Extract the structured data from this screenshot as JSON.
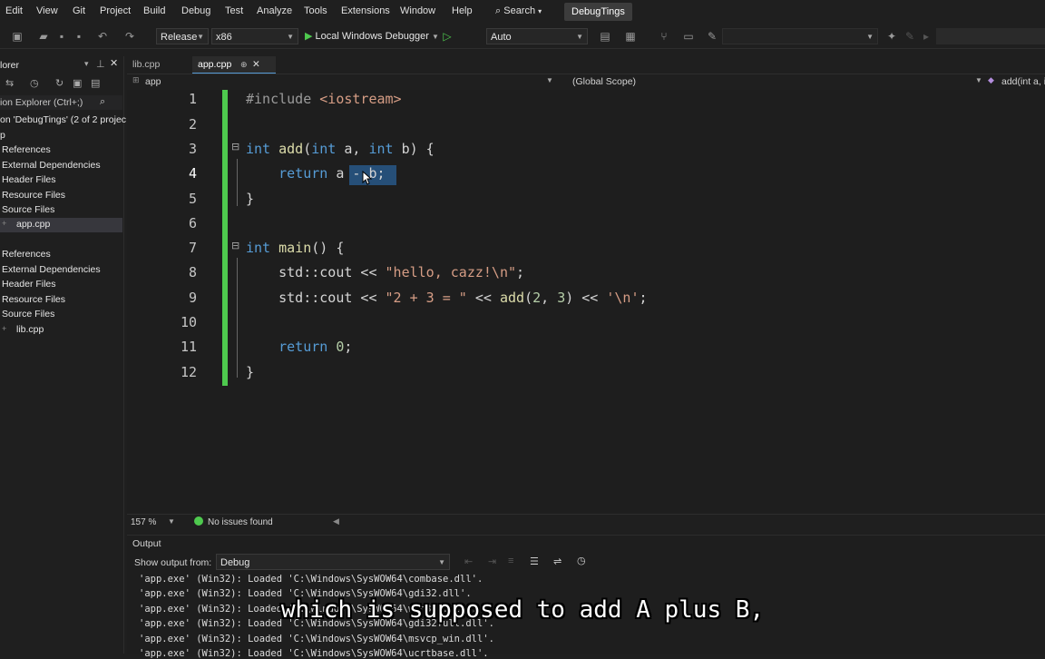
{
  "menu": [
    "Edit",
    "View",
    "Git",
    "Project",
    "Build",
    "Debug",
    "Test",
    "Analyze",
    "Tools",
    "Extensions",
    "Window",
    "Help"
  ],
  "search_label": "Search",
  "solution_name": "DebugTings",
  "toolbar": {
    "config": "Release",
    "platform": "x86",
    "debugger": "Local Windows Debugger",
    "auto": "Auto"
  },
  "solution_explorer": {
    "title": "lorer",
    "search_placeholder": "ion Explorer (Ctrl+;)",
    "solution_line": "on 'DebugTings' (2 of 2 projec",
    "project_marker": "p",
    "items": [
      "References",
      "External Dependencies",
      "Header Files",
      "Resource Files",
      "Source Files",
      "app.cpp",
      "References",
      "External Dependencies",
      "Header Files",
      "Resource Files",
      "Source Files",
      "lib.cpp"
    ]
  },
  "tabs": [
    {
      "label": "lib.cpp"
    },
    {
      "label": "app.cpp",
      "pin": "⊕"
    }
  ],
  "navbar": {
    "project": "app",
    "scope": "(Global Scope)",
    "member": "add(int a, i"
  },
  "editor": {
    "line_numbers": [
      "1",
      "2",
      "3",
      "4",
      "5",
      "6",
      "7",
      "8",
      "9",
      "10",
      "11",
      "12"
    ],
    "zoom": "157 %",
    "issues": "No issues found"
  },
  "output": {
    "title": "Output",
    "show_from_label": "Show output from:",
    "source": "Debug",
    "lines": [
      "'app.exe' (Win32): Loaded 'C:\\Windows\\SysWOW64\\combase.dll'.",
      "'app.exe' (Win32): Loaded 'C:\\Windows\\SysWOW64\\gdi32.dll'.",
      "'app.exe' (Win32): Loaded 'C:\\Windows\\SysWOW64\\win32u.dll'.",
      "'app.exe' (Win32): Loaded 'C:\\Windows\\SysWOW64\\gdi32full.dll'.",
      "'app.exe' (Win32): Loaded 'C:\\Windows\\SysWOW64\\msvcp_win.dll'.",
      "'app.exe' (Win32): Loaded 'C:\\Windows\\SysWOW64\\ucrtbase.dll'."
    ]
  },
  "subtitle": "which is supposed to add A plus B,",
  "colors": {
    "accent": "#569cd6",
    "change_bar": "#4ec94e",
    "selection": "#264f78"
  }
}
